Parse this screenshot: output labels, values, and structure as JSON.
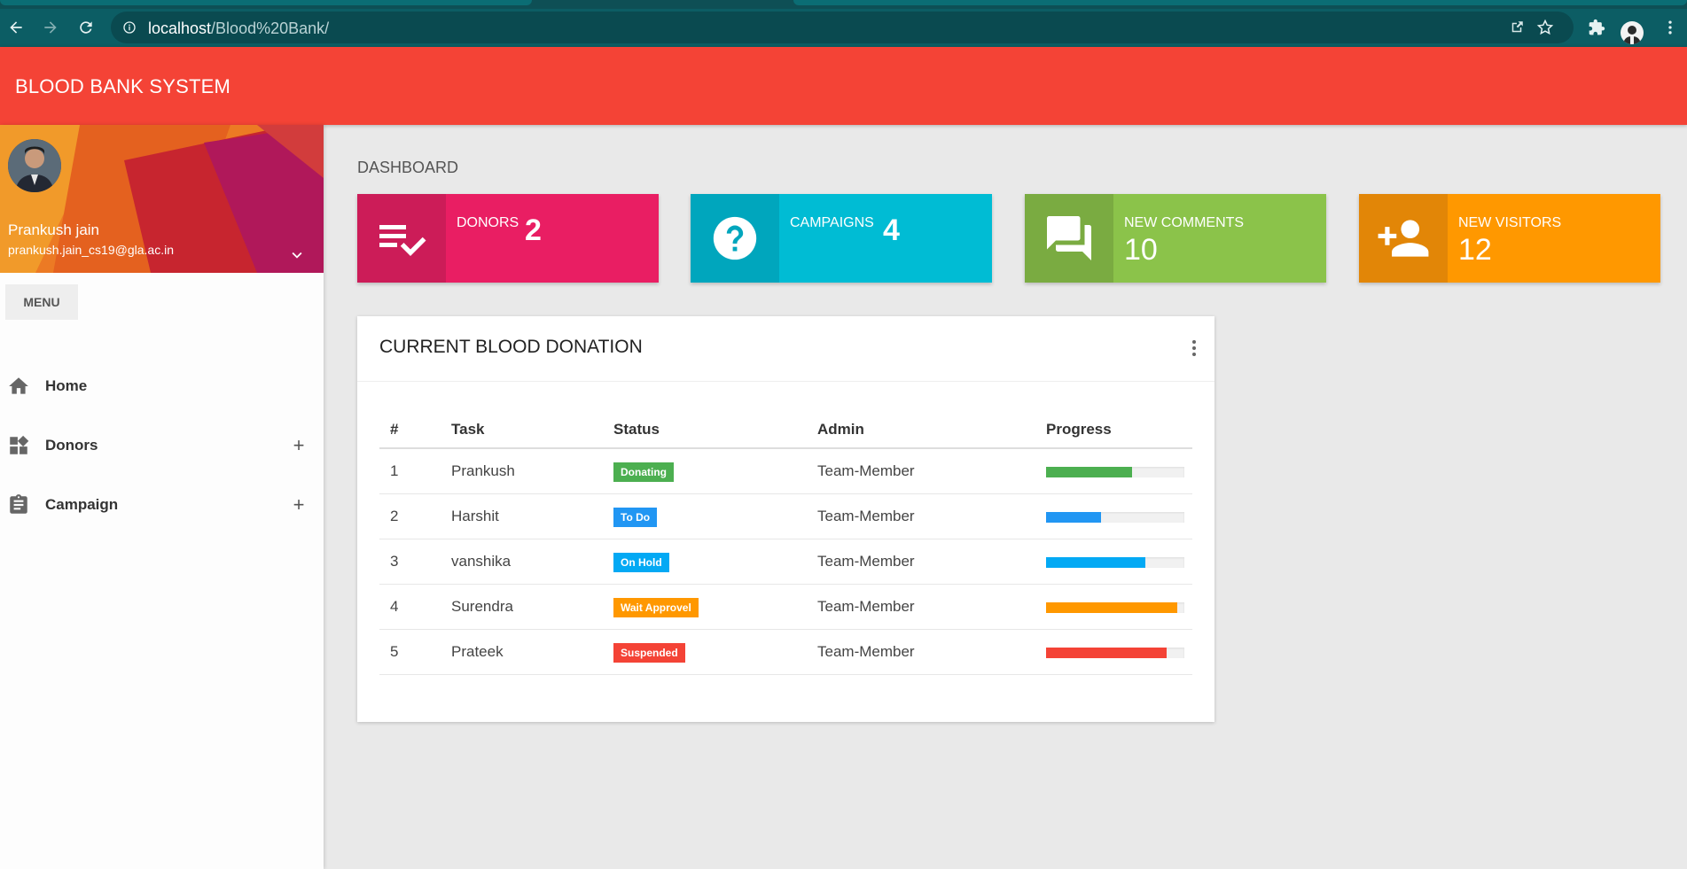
{
  "browser": {
    "url_host": "localhost",
    "url_path": "/Blood%20Bank/",
    "icons": [
      "back-icon",
      "forward-icon",
      "reload-icon",
      "info-icon",
      "share-icon",
      "star-icon",
      "puzzle-icon",
      "profile-avatar",
      "more-vert-icon"
    ]
  },
  "header": {
    "title": "BLOOD BANK SYSTEM"
  },
  "user": {
    "name": "Prankush jain",
    "email": "prankush.jain_cs19@gla.ac.in"
  },
  "menu": {
    "header": "MENU",
    "items": [
      {
        "label": "Home",
        "icon": "home-icon",
        "expandable": false
      },
      {
        "label": "Donors",
        "icon": "widgets-icon",
        "expandable": true
      },
      {
        "label": "Campaign",
        "icon": "assignment-icon",
        "expandable": true
      }
    ],
    "expand_symbol": "+"
  },
  "dashboard": {
    "title": "DASHBOARD",
    "info_boxes": [
      {
        "label": "DONORS",
        "value": "2",
        "icon": "playlist-check-icon",
        "color": "#e91e63",
        "icon_bg": "#cc1c58"
      },
      {
        "label": "CAMPAIGNS",
        "value": "4",
        "icon": "help-icon",
        "color": "#00bcd4",
        "icon_bg": "#00a6bd"
      },
      {
        "label": "NEW COMMENTS",
        "value": "10",
        "icon": "forum-icon",
        "color": "#8bc34a",
        "icon_bg": "#7aab41"
      },
      {
        "label": "NEW VISITORS",
        "value": "12",
        "icon": "person-add-icon",
        "color": "#ff9800",
        "icon_bg": "#e28607"
      }
    ]
  },
  "donations": {
    "title": "CURRENT BLOOD DONATION",
    "columns": [
      "#",
      "Task",
      "Status",
      "Admin",
      "Progress"
    ],
    "rows": [
      {
        "num": "1",
        "task": "Prankush",
        "status": "Donating",
        "status_color": "#4caf50",
        "admin": "Team-Member",
        "progress": 0.62,
        "progress_color": "#4caf50"
      },
      {
        "num": "2",
        "task": "Harshit",
        "status": "To Do",
        "status_color": "#2196f3",
        "admin": "Team-Member",
        "progress": 0.4,
        "progress_color": "#2196f3"
      },
      {
        "num": "3",
        "task": "vanshika",
        "status": "On Hold",
        "status_color": "#03a9f4",
        "admin": "Team-Member",
        "progress": 0.72,
        "progress_color": "#03a9f4"
      },
      {
        "num": "4",
        "task": "Surendra",
        "status": "Wait Approvel",
        "status_color": "#ff9800",
        "admin": "Team-Member",
        "progress": 0.95,
        "progress_color": "#ff9800"
      },
      {
        "num": "5",
        "task": "Prateek",
        "status": "Suspended",
        "status_color": "#f44336",
        "admin": "Team-Member",
        "progress": 0.87,
        "progress_color": "#f44336"
      }
    ]
  }
}
